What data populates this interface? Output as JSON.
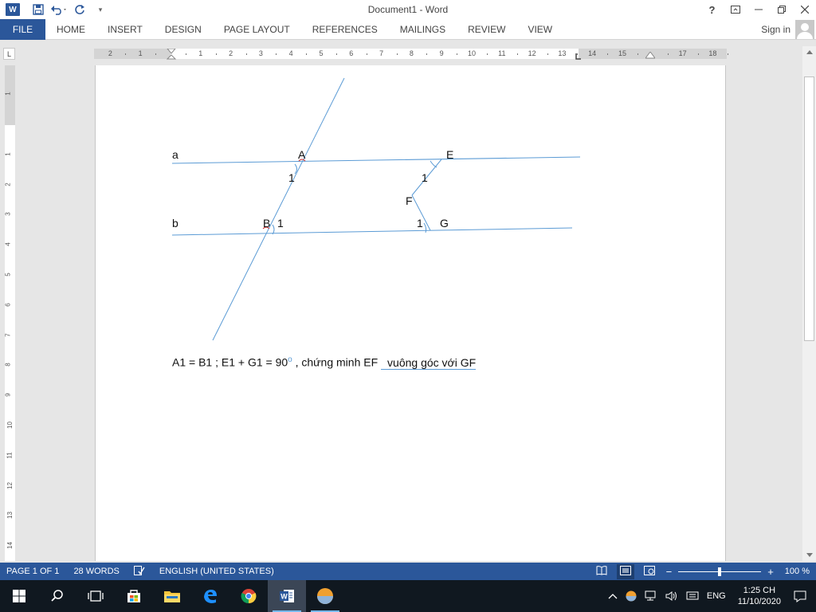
{
  "window": {
    "title": "Document1 - Word",
    "controls": [
      "?",
      "ribbon-display",
      "minimize",
      "restore",
      "close"
    ]
  },
  "qat": {
    "app_icon_label": "W",
    "customize_label": "▾"
  },
  "ribbon": {
    "file_label": "FILE",
    "tabs": [
      "HOME",
      "INSERT",
      "DESIGN",
      "PAGE LAYOUT",
      "REFERENCES",
      "MAILINGS",
      "REVIEW",
      "VIEW"
    ],
    "sign_in": "Sign in"
  },
  "ruler": {
    "corner": "L",
    "h_ticks": [
      "2",
      "1",
      "",
      "1",
      "2",
      "3",
      "4",
      "5",
      "6",
      "7",
      "8",
      "9",
      "10",
      "11",
      "12",
      "13",
      "14",
      "15",
      "",
      "17",
      "18"
    ],
    "v_ticks": [
      "1",
      "",
      "1",
      "2",
      "3",
      "4",
      "5",
      "6",
      "7",
      "8",
      "9",
      "10",
      "11",
      "12",
      "13",
      "14"
    ]
  },
  "figure": {
    "labels": {
      "a": "a",
      "b": "b",
      "A": "A",
      "B": "B",
      "E": "E",
      "F": "F",
      "G": "G",
      "angle_A": "1",
      "angle_B": "1",
      "angle_E": "1",
      "angle_G": "1"
    },
    "line_color": "#5b9bd5"
  },
  "document": {
    "problem": "A1 = B1 ; E1 + G1 = 90",
    "degree": "o",
    "problem_rest": ", chứng minh EF",
    "problem_end": "vuông góc với GF"
  },
  "statusbar": {
    "page": "PAGE 1 OF 1",
    "words": "28 WORDS",
    "language": "ENGLISH (UNITED STATES)",
    "zoom": "100 %",
    "zoom_minus": "−",
    "zoom_plus": "+",
    "zoom_fraction": 0.5
  },
  "taskbar": {
    "tray_lang": "ENG",
    "time": "1:25 CH",
    "date": "11/10/2020"
  },
  "colors": {
    "accent": "#2b579a",
    "taskbar": "#101820"
  }
}
